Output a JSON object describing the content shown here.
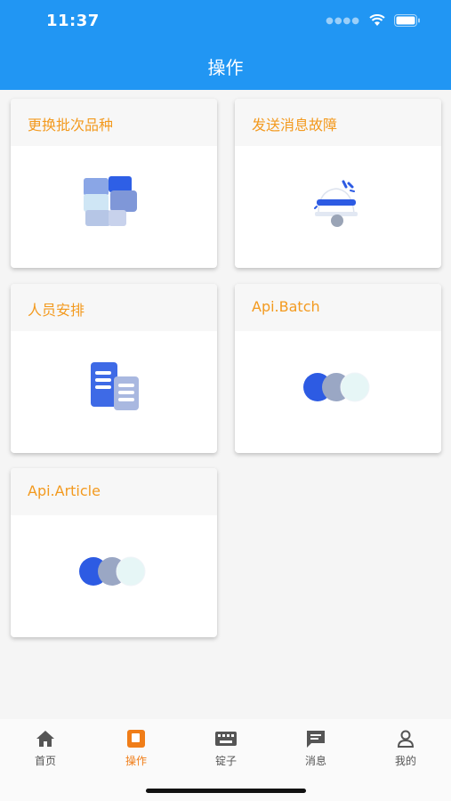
{
  "status_bar": {
    "time": "11:37"
  },
  "header": {
    "title": "操作"
  },
  "cards": [
    {
      "title": "更换批次品种",
      "icon": "cubes-icon"
    },
    {
      "title": "发送消息故障",
      "icon": "bell-icon"
    },
    {
      "title": "人员安排",
      "icon": "documents-icon"
    },
    {
      "title": "Api.Batch",
      "icon": "circles-icon"
    },
    {
      "title": "Api.Article",
      "icon": "circles-icon"
    }
  ],
  "tabbar": {
    "items": [
      {
        "label": "首页",
        "icon": "home-icon"
      },
      {
        "label": "操作",
        "icon": "operation-icon",
        "active": true
      },
      {
        "label": "锭子",
        "icon": "keyboard-icon"
      },
      {
        "label": "消息",
        "icon": "message-icon"
      },
      {
        "label": "我的",
        "icon": "person-icon"
      }
    ]
  },
  "colors": {
    "primary": "#2196f3",
    "accent": "#f39a1f",
    "tab_active": "#f07d18"
  }
}
